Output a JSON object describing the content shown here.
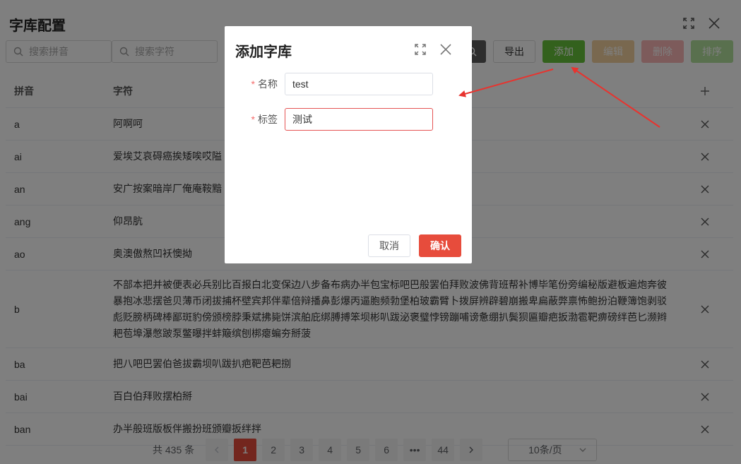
{
  "window": {
    "title": "字库配置"
  },
  "toolbar": {
    "pinyin_placeholder": "搜索拼音",
    "char_placeholder": "搜索字符",
    "export_label": "导出",
    "add_label": "添加",
    "edit_label": "编辑",
    "delete_label": "删除",
    "sort_label": "排序"
  },
  "table": {
    "headers": {
      "pinyin": "拼音",
      "chars": "字符",
      "add": "+"
    },
    "rows": [
      {
        "pinyin": "a",
        "chars": "阿啊呵"
      },
      {
        "pinyin": "ai",
        "chars": "爱埃艾哀碍癌挨矮唉哎隘"
      },
      {
        "pinyin": "an",
        "chars": "安广按案暗岸厂俺庵鞍黯"
      },
      {
        "pinyin": "ang",
        "chars": "仰昂肮"
      },
      {
        "pinyin": "ao",
        "chars": "奥澳傲熬凹袄懊拗"
      },
      {
        "pinyin": "b",
        "chars": "不部本把并被便表必兵别比百报白北变保边八步备布病办半包宝标吧巴般罢伯拜败波佛背班帮补博毕笔份旁编秘版避板遍炮奔彼暴抱冰悲摆爸贝薄币闭拔捕杯壁宾邦伴辈倍辩播鼻彭爆丙逼胞频勃堡柏玻霸臂卜拨屏辨辟碧崩搬卑扁蔽弊禀怖鲍扮泊鞭簿饱剥驳彪贬膀柄碑棒鄙斑豹傍颁榜脖秉斌拂毙饼滨舶庇绑膊搏笨坝彬叭跋泌褒璧悖镑蹦哺谤惫绷扒鬓狈匾瓣疤扳渤雹靶痹磅绊芭匕濒辫耙苞埠瀑憋跛泵鳖曝拌蚌簸缤刨梆瘪蝙夯掰菠"
      },
      {
        "pinyin": "ba",
        "chars": "把八吧巴罢伯爸拔霸坝叭跋扒疤靶芭耙捌"
      },
      {
        "pinyin": "bai",
        "chars": "百白伯拜败摆柏掰"
      },
      {
        "pinyin": "ban",
        "chars": "办半般班版板伴搬扮班颁瓣扳绊拌"
      }
    ]
  },
  "pagination": {
    "total": "共 435 条",
    "pages": [
      "1",
      "2",
      "3",
      "4",
      "5",
      "6",
      "•••",
      "44"
    ],
    "current": "1",
    "page_size": "10条/页"
  },
  "dialog": {
    "title": "添加字库",
    "name_label": "名称",
    "name_value": "test",
    "tag_label": "标签",
    "tag_value": "测试",
    "cancel_label": "取消",
    "confirm_label": "确认"
  },
  "colors": {
    "add": "#67c23a",
    "edit": "#f3d19e",
    "delete": "#fab6b6",
    "sort": "#b3e19d",
    "primary": "#e74c3c",
    "annotation_arrow": "#e8332e"
  }
}
